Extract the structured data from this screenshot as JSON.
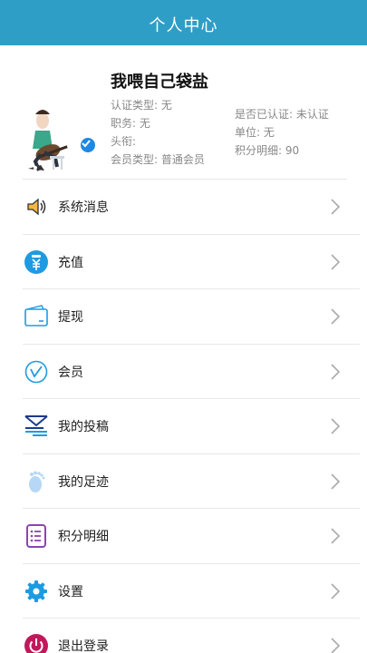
{
  "header": {
    "title": "个人中心"
  },
  "profile": {
    "name": "我喂自己袋盐",
    "cert_type": "认证类型: 无",
    "position": "职务: 无",
    "title": "头衔:",
    "member_type": "会员类型: 普通会员",
    "verified": "是否已认证: 未认证",
    "unit": "单位: 无",
    "points": "积分明细: 90"
  },
  "menu": [
    {
      "label": "系统消息",
      "icon": "speaker-icon"
    },
    {
      "label": "充值",
      "icon": "recharge-icon"
    },
    {
      "label": "提现",
      "icon": "wallet-icon"
    },
    {
      "label": "会员",
      "icon": "member-icon"
    },
    {
      "label": "我的投稿",
      "icon": "submission-icon"
    },
    {
      "label": "我的足迹",
      "icon": "footprint-icon"
    },
    {
      "label": "积分明细",
      "icon": "points-list-icon"
    },
    {
      "label": "设置",
      "icon": "gear-icon"
    },
    {
      "label": "退出登录",
      "icon": "power-icon"
    }
  ],
  "colors": {
    "header_bg": "#2f9ec6",
    "accent_blue": "#1e88e5",
    "purple": "#8e44ad",
    "magenta": "#c2185b"
  }
}
